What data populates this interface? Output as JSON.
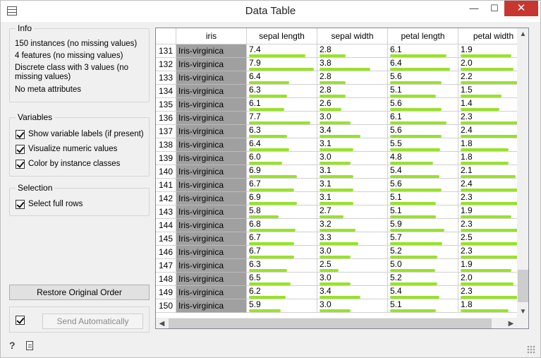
{
  "window": {
    "title": "Data Table",
    "min_glyph": "—",
    "max_glyph": "☐",
    "close_glyph": "✕"
  },
  "info": {
    "title": "Info",
    "lines": [
      "150 instances (no missing values)",
      "4 features (no missing values)",
      "Discrete class with 3 values (no missing values)",
      "No meta attributes"
    ]
  },
  "variables": {
    "title": "Variables",
    "options": [
      {
        "label": "Show variable labels (if present)",
        "checked": true
      },
      {
        "label": "Visualize numeric values",
        "checked": true
      },
      {
        "label": "Color by instance classes",
        "checked": true
      }
    ]
  },
  "selection": {
    "title": "Selection",
    "options": [
      {
        "label": "Select full rows",
        "checked": true
      }
    ]
  },
  "buttons": {
    "restore": "Restore Original Order",
    "send": "Send Automatically",
    "auto_checked": true
  },
  "colors": {
    "bar": "#99e22a",
    "class_cell": "#a0a0a0",
    "close": "#c7372f"
  },
  "table": {
    "columns": [
      "iris",
      "sepal length",
      "sepal width",
      "petal length",
      "petal width"
    ],
    "ranges": {
      "sepal length": [
        4.3,
        7.9
      ],
      "sepal width": [
        2.0,
        4.4
      ],
      "petal length": [
        1.0,
        6.9
      ],
      "petal width": [
        0.1,
        2.5
      ]
    },
    "rows": [
      {
        "n": "131",
        "cls": "Iris-virginica",
        "v": [
          "7.4",
          "2.8",
          "6.1",
          "1.9"
        ]
      },
      {
        "n": "132",
        "cls": "Iris-virginica",
        "v": [
          "7.9",
          "3.8",
          "6.4",
          "2.0"
        ]
      },
      {
        "n": "133",
        "cls": "Iris-virginica",
        "v": [
          "6.4",
          "2.8",
          "5.6",
          "2.2"
        ]
      },
      {
        "n": "134",
        "cls": "Iris-virginica",
        "v": [
          "6.3",
          "2.8",
          "5.1",
          "1.5"
        ]
      },
      {
        "n": "135",
        "cls": "Iris-virginica",
        "v": [
          "6.1",
          "2.6",
          "5.6",
          "1.4"
        ]
      },
      {
        "n": "136",
        "cls": "Iris-virginica",
        "v": [
          "7.7",
          "3.0",
          "6.1",
          "2.3"
        ]
      },
      {
        "n": "137",
        "cls": "Iris-virginica",
        "v": [
          "6.3",
          "3.4",
          "5.6",
          "2.4"
        ]
      },
      {
        "n": "138",
        "cls": "Iris-virginica",
        "v": [
          "6.4",
          "3.1",
          "5.5",
          "1.8"
        ]
      },
      {
        "n": "139",
        "cls": "Iris-virginica",
        "v": [
          "6.0",
          "3.0",
          "4.8",
          "1.8"
        ]
      },
      {
        "n": "140",
        "cls": "Iris-virginica",
        "v": [
          "6.9",
          "3.1",
          "5.4",
          "2.1"
        ]
      },
      {
        "n": "141",
        "cls": "Iris-virginica",
        "v": [
          "6.7",
          "3.1",
          "5.6",
          "2.4"
        ]
      },
      {
        "n": "142",
        "cls": "Iris-virginica",
        "v": [
          "6.9",
          "3.1",
          "5.1",
          "2.3"
        ]
      },
      {
        "n": "143",
        "cls": "Iris-virginica",
        "v": [
          "5.8",
          "2.7",
          "5.1",
          "1.9"
        ]
      },
      {
        "n": "144",
        "cls": "Iris-virginica",
        "v": [
          "6.8",
          "3.2",
          "5.9",
          "2.3"
        ]
      },
      {
        "n": "145",
        "cls": "Iris-virginica",
        "v": [
          "6.7",
          "3.3",
          "5.7",
          "2.5"
        ]
      },
      {
        "n": "146",
        "cls": "Iris-virginica",
        "v": [
          "6.7",
          "3.0",
          "5.2",
          "2.3"
        ]
      },
      {
        "n": "147",
        "cls": "Iris-virginica",
        "v": [
          "6.3",
          "2.5",
          "5.0",
          "1.9"
        ]
      },
      {
        "n": "148",
        "cls": "Iris-virginica",
        "v": [
          "6.5",
          "3.0",
          "5.2",
          "2.0"
        ]
      },
      {
        "n": "149",
        "cls": "Iris-virginica",
        "v": [
          "6.2",
          "3.4",
          "5.4",
          "2.3"
        ]
      },
      {
        "n": "150",
        "cls": "Iris-virginica",
        "v": [
          "5.9",
          "3.0",
          "5.1",
          "1.8"
        ]
      }
    ]
  }
}
